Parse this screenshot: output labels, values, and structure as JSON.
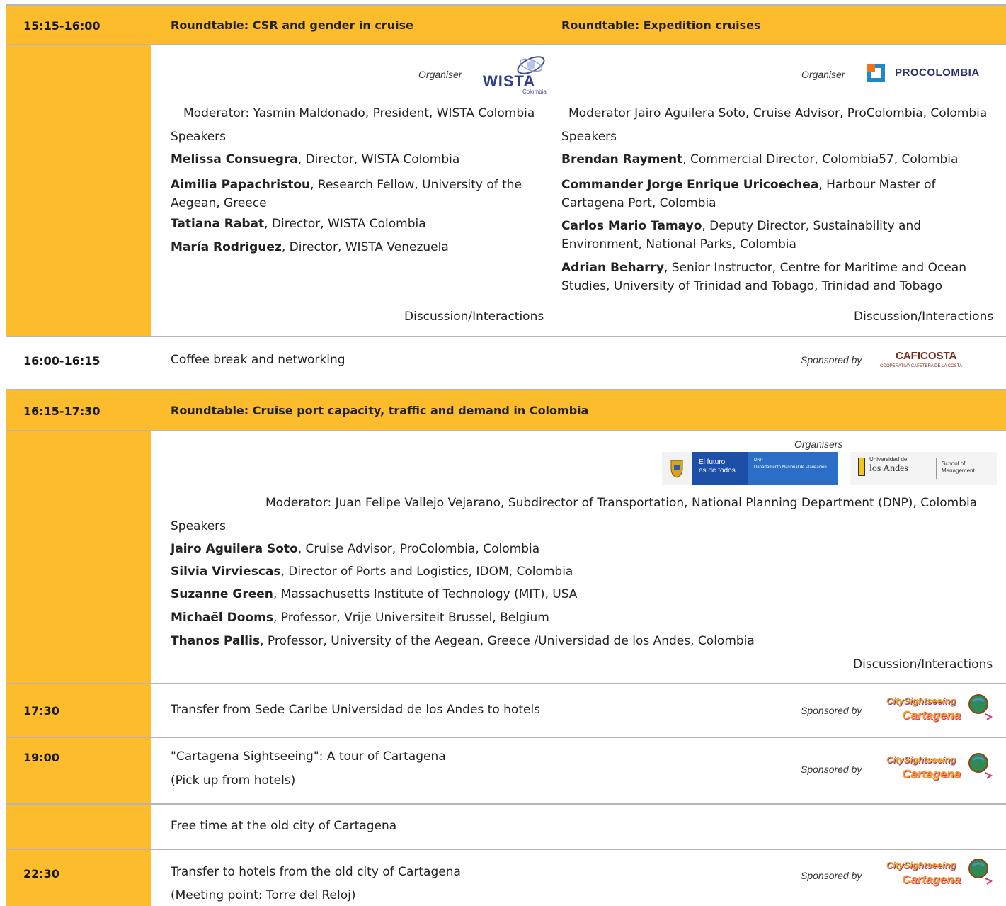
{
  "block1": {
    "time": "15:15-16:00",
    "left": {
      "title": "Roundtable: CSR and gender in cruise",
      "organiser_label": "Organiser",
      "logo_text": "WISTA",
      "logo_sub": "Colombia",
      "moderator": "Moderator: Yasmin Maldonado, President, WISTA Colombia",
      "speakers_label": "Speakers",
      "speakers": [
        {
          "name": "Melissa Consuegra",
          "role": ", Director, WISTA Colombia"
        },
        {
          "name": "Aimilia Papachristou",
          "role": ", Research Fellow, University of the Aegean, Greece"
        },
        {
          "name": "Tatiana Rabat",
          "role": ", Director, WISTA Colombia"
        },
        {
          "name": "María Rodriguez",
          "role": ", Director, WISTA Venezuela"
        }
      ],
      "discussion": "Discussion/Interactions"
    },
    "right": {
      "title": "Roundtable: Expedition cruises",
      "organiser_label": "Organiser",
      "logo_text": "PROCOLOMBIA",
      "moderator": "Moderator Jairo Aguilera Soto, Cruise Advisor, ProColombia, Colombia",
      "speakers_label": "Speakers",
      "speakers": [
        {
          "name": "Brendan Rayment",
          "role": ", Commercial Director, Colombia57, Colombia"
        },
        {
          "name": "Commander Jorge Enrique Uricoechea",
          "role": ", Harbour Master of Cartagena Port, Colombia"
        },
        {
          "name": "Carlos Mario Tamayo",
          "role": ", Deputy Director, Sustainability and Environment, National Parks, Colombia"
        },
        {
          "name": "Adrian Beharry",
          "role": ", Senior Instructor, Centre for Maritime and Ocean Studies, University of Trinidad and Tobago, Trinidad and Tobago"
        }
      ],
      "discussion": "Discussion/Interactions"
    }
  },
  "coffee": {
    "time": "16:00-16:15",
    "text": "Coffee break and networking",
    "sponsored_label": "Sponsored by",
    "logo_text": "CAFICOSTA",
    "logo_sub": "COOPERATIVA CAFETERA DE LA COSTA"
  },
  "block2": {
    "time": "16:15-17:30",
    "title": "Roundtable: Cruise port capacity, traffic and demand in Colombia",
    "organisers_label": "Organisers",
    "logo1_text1": "El futuro",
    "logo1_text2": "es de todos",
    "logo1_text3": "DNP",
    "logo1_text4": "Departamento Nacional de Planeación",
    "logo2_text1": "Universidad de",
    "logo2_text2": "los Andes",
    "logo2_text3": "School of Management",
    "moderator": "Moderator: Juan Felipe Vallejo Vejarano, Subdirector of Transportation, National Planning Department (DNP), Colombia",
    "speakers_label": "Speakers",
    "speakers": [
      {
        "name": "Jairo Aguilera Soto",
        "role": ", Cruise Advisor, ProColombia, Colombia"
      },
      {
        "name": "Silvia Virviescas",
        "role": ", Director of Ports and Logistics, IDOM, Colombia"
      },
      {
        "name": "Suzanne Green",
        "role": ", Massachusetts Institute of Technology (MIT), USA"
      },
      {
        "name": "Michaël Dooms",
        "role": ", Professor, Vrije Universiteit Brussel, Belgium"
      },
      {
        "name": "Thanos Pallis",
        "role": ", Professor, University of the Aegean, Greece /Universidad de los Andes, Colombia"
      }
    ],
    "discussion": "Discussion/Interactions"
  },
  "transfer1": {
    "time": "17:30",
    "text": "Transfer from Sede Caribe Universidad de los Andes to hotels",
    "sponsored_label": "Sponsored by"
  },
  "tour": {
    "time": "19:00",
    "line1": "\"Cartagena Sightseeing\": A tour of Cartagena",
    "line2": "(Pick up from hotels)",
    "sponsored_label": "Sponsored by"
  },
  "free": {
    "text": "Free time at the old city of Cartagena"
  },
  "transfer2": {
    "time": "22:30",
    "line1": "Transfer to hotels from the old city of Cartagena",
    "line2": "(Meeting point: Torre del Reloj)",
    "sponsored_label": "Sponsored by"
  },
  "citysightseeing": {
    "line1": "CitySightseeing",
    "line2": "Cartagena"
  },
  "colors": {
    "gold": "#fdbc2c",
    "procolombia_blue": "#1e88c8",
    "procolombia_orange": "#f0731e"
  }
}
